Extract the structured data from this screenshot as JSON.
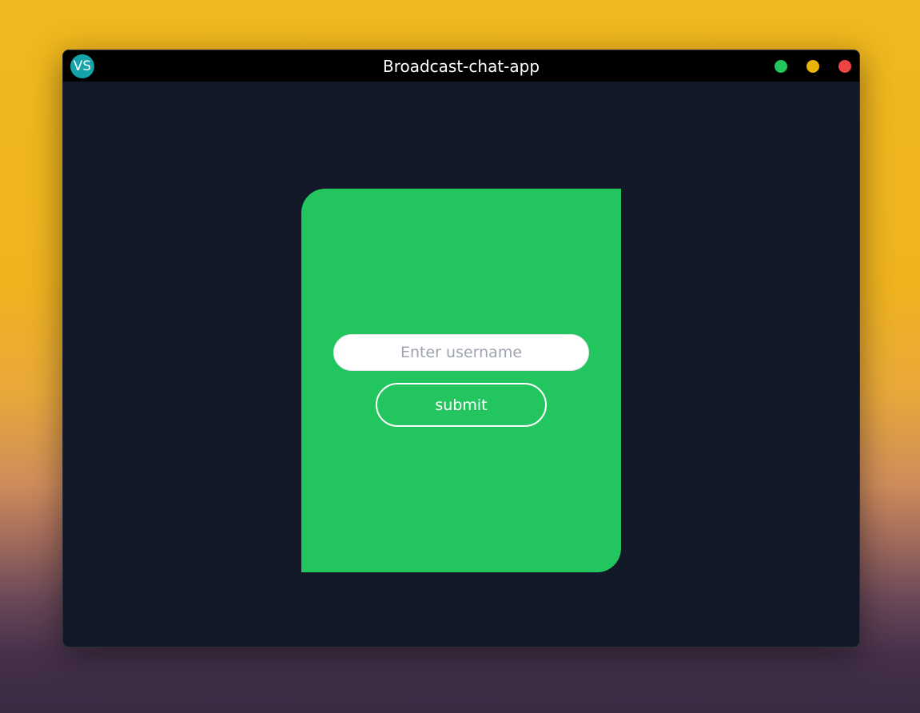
{
  "window": {
    "title": "Broadcast-chat-app",
    "logo_text": "VS",
    "controls": {
      "green_icon": "maximize-dot",
      "yellow_icon": "minimize-dot",
      "red_icon": "close-dot"
    }
  },
  "login": {
    "username_value": "",
    "username_placeholder": "Enter username",
    "submit_label": "submit"
  },
  "colors": {
    "card": "#22c55e",
    "window_bg": "#121828",
    "titlebar": "#000000",
    "logo": "#13a3a8",
    "dot_green": "#22c55e",
    "dot_yellow": "#eab308",
    "dot_red": "#ef4444"
  }
}
